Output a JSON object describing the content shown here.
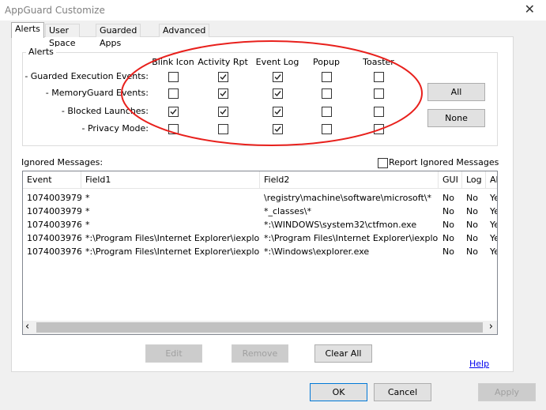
{
  "window": {
    "title": "AppGuard Customize",
    "close_glyph": "✕"
  },
  "tabs": [
    {
      "label": "Alerts",
      "active": true
    },
    {
      "label": "User Space",
      "active": false
    },
    {
      "label": "Guarded Apps",
      "active": false
    },
    {
      "label": "Advanced",
      "active": false
    }
  ],
  "alerts": {
    "group_title": "Alerts",
    "columns": [
      "Blink Icon",
      "Activity Rpt",
      "Event Log",
      "Popup",
      "Toaster"
    ],
    "rows": [
      {
        "label": "- Guarded Execution Events:",
        "checks": [
          false,
          true,
          true,
          false,
          false
        ]
      },
      {
        "label": "- MemoryGuard Events:",
        "checks": [
          false,
          true,
          true,
          false,
          false
        ]
      },
      {
        "label": "- Blocked Launches:",
        "checks": [
          true,
          true,
          true,
          false,
          false
        ]
      },
      {
        "label": "- Privacy Mode:",
        "checks": [
          false,
          false,
          true,
          false,
          false
        ]
      }
    ],
    "all_button": "All",
    "none_button": "None",
    "annotation_color": "#e8201c"
  },
  "ignored": {
    "title": "Ignored Messages:",
    "report_label": "Report Ignored Messages",
    "report_checked": false,
    "columns": [
      "Event",
      "Field1",
      "Field2",
      "GUI",
      "Log",
      "Al"
    ],
    "rows": [
      [
        "1074003979",
        "*",
        "\\registry\\machine\\software\\microsoft\\*",
        "No",
        "No",
        "Ye"
      ],
      [
        "1074003979",
        "*",
        "*_classes\\*",
        "No",
        "No",
        "Ye"
      ],
      [
        "1074003976",
        "*",
        "*:\\WINDOWS\\system32\\ctfmon.exe",
        "No",
        "No",
        "Ye"
      ],
      [
        "1074003976",
        "*:\\Program Files\\Internet Explorer\\iexplor...",
        "*:\\Program Files\\Internet Explorer\\iexplor...",
        "No",
        "No",
        "Ye"
      ],
      [
        "1074003976",
        "*:\\Program Files\\Internet Explorer\\iexplor...",
        "*:\\Windows\\explorer.exe",
        "No",
        "No",
        "Ye"
      ]
    ],
    "scroll_left": "‹",
    "scroll_right": "›",
    "edit_button": "Edit",
    "remove_button": "Remove",
    "clear_button": "Clear All"
  },
  "help_link": "Help",
  "footer": {
    "ok": "OK",
    "cancel": "Cancel",
    "apply": "Apply"
  }
}
